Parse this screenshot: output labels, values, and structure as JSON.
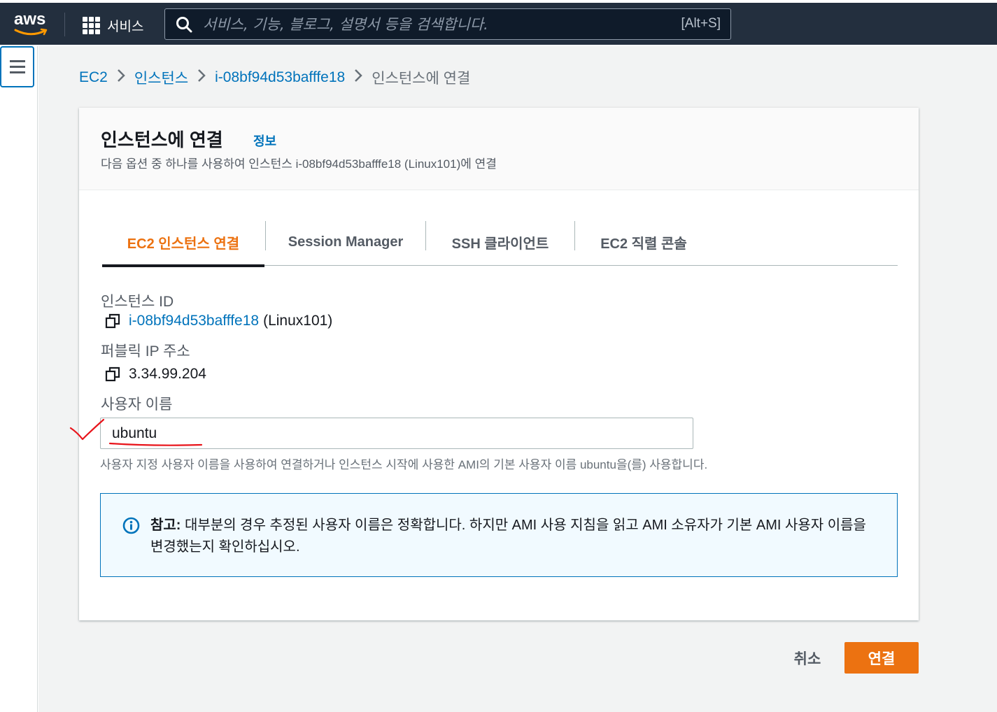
{
  "nav": {
    "logo_text": "aws",
    "services_label": "서비스",
    "search_placeholder": "서비스, 기능, 블로그, 설명서 등을 검색합니다.",
    "search_shortcut": "[Alt+S]"
  },
  "breadcrumb": {
    "items": [
      "EC2",
      "인스턴스",
      "i-08bf94d53bafffe18"
    ],
    "current": "인스턴스에 연결"
  },
  "card": {
    "title": "인스턴스에 연결",
    "info_link": "정보",
    "description": "다음 옵션 중 하나를 사용하여 인스턴스 i-08bf94d53bafffe18 (Linux101)에 연결"
  },
  "tabs": [
    {
      "label": "EC2 인스턴스 연결",
      "active": true
    },
    {
      "label": "Session Manager",
      "active": false
    },
    {
      "label": "SSH 클라이언트",
      "active": false
    },
    {
      "label": "EC2 직렬 콘솔",
      "active": false
    }
  ],
  "fields": {
    "instance_id_label": "인스턴스 ID",
    "instance_id_value": "i-08bf94d53bafffe18",
    "instance_name": "(Linux101)",
    "public_ip_label": "퍼블릭 IP 주소",
    "public_ip_value": "3.34.99.204",
    "username_label": "사용자 이름",
    "username_value": "ubuntu",
    "username_hint": "사용자 지정 사용자 이름을 사용하여 연결하거나 인스턴스 시작에 사용한 AMI의 기본 사용자 이름 ubuntu을(를) 사용합니다."
  },
  "alert": {
    "bold": "참고:",
    "text": " 대부분의 경우 추정된 사용자 이름은 정확합니다. 하지만 AMI 사용 지침을 읽고 AMI 소유자가 기본 AMI 사용자 이름을 변경했는지 확인하십시오."
  },
  "footer": {
    "cancel_label": "취소",
    "connect_label": "연결"
  },
  "colors": {
    "nav_bg": "#232f3e",
    "accent": "#ec7211",
    "link": "#0073bb",
    "annotation": "#e8141b"
  }
}
